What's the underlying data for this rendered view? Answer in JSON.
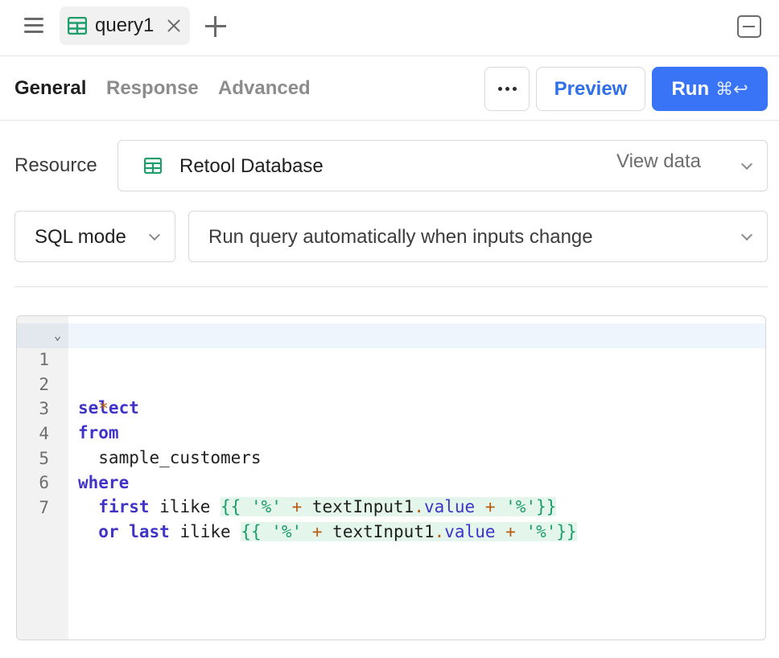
{
  "top_bar": {
    "query_tab_label": "query1"
  },
  "sub_tabs": [
    "General",
    "Response",
    "Advanced"
  ],
  "actions": {
    "preview_label": "Preview",
    "run_label": "Run",
    "run_shortcut": "⌘↩"
  },
  "resource": {
    "label": "Resource",
    "value": "Retool Database",
    "view_data_label": "View data"
  },
  "mode": {
    "value": "SQL mode"
  },
  "trigger": {
    "value": "Run query automatically when inputs change"
  },
  "editor": {
    "line_numbers": [
      "1",
      "2",
      "3",
      "4",
      "5",
      "6",
      "7"
    ],
    "lines": [
      "select",
      "  *",
      "from",
      "  sample_customers",
      "where",
      "  first ilike {{ '%' + textInput1.value + '%'}}",
      "  or last ilike {{ '%' + textInput1.value + '%'}}"
    ]
  },
  "colors": {
    "accent": "#3874f5",
    "keyword": "#4034c8",
    "operator": "#b85a10",
    "template": "#1a9c6e",
    "db_icon": "#1f9d6a"
  }
}
